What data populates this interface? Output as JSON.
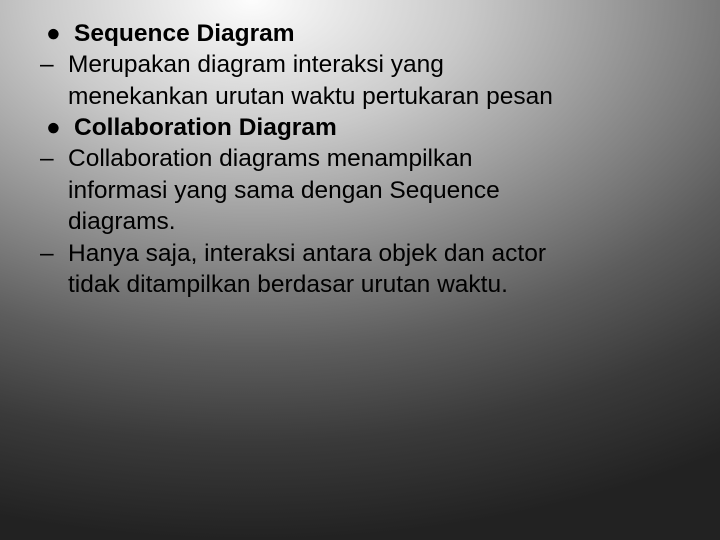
{
  "slide": {
    "items": [
      {
        "marker": "●",
        "bold": true,
        "text": "Sequence Diagram"
      },
      {
        "marker": "–",
        "bold": false,
        "text": "Merupakan diagram interaksi yang"
      },
      {
        "marker": "",
        "bold": false,
        "text": "menekankan urutan waktu pertukaran pesan"
      },
      {
        "marker": "●",
        "bold": true,
        "text": "Collaboration Diagram"
      },
      {
        "marker": "–",
        "bold": false,
        "text": "Collaboration diagrams menampilkan"
      },
      {
        "marker": "",
        "bold": false,
        "text": "informasi yang sama dengan Sequence"
      },
      {
        "marker": "",
        "bold": false,
        "text": "diagrams."
      },
      {
        "marker": "–",
        "bold": false,
        "text": "Hanya saja, interaksi antara objek dan actor"
      },
      {
        "marker": "",
        "bold": false,
        "text": "tidak ditampilkan berdasar urutan waktu."
      }
    ]
  }
}
